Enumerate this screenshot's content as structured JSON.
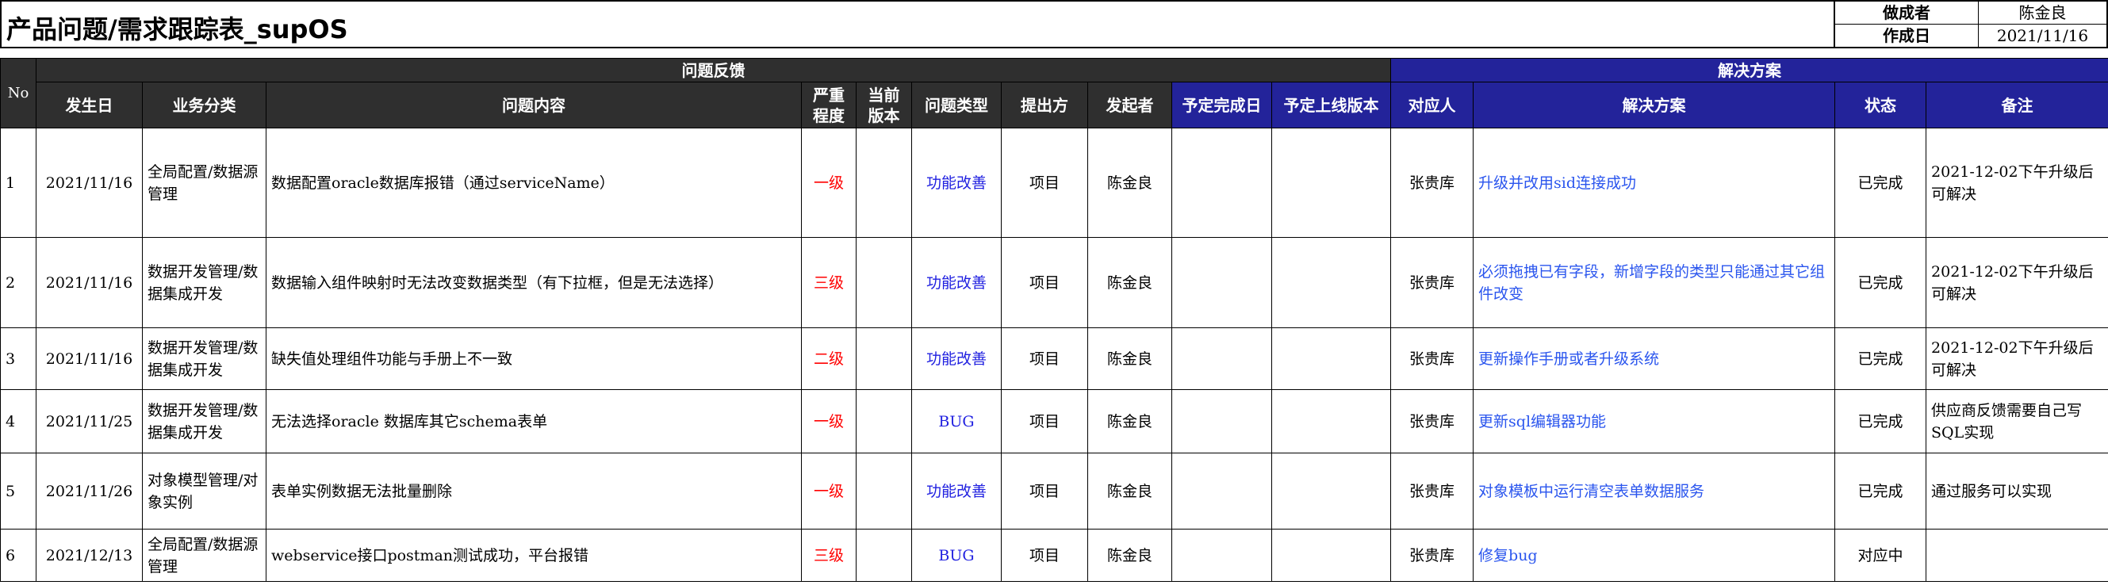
{
  "header": {
    "title": "产品问题/需求跟踪表_supOS",
    "author_label": "做成者",
    "author_value": "陈金良",
    "date_label": "作成日",
    "date_value": "2021/11/16"
  },
  "groups": {
    "feedback": "问题反馈",
    "solution": "解决方案"
  },
  "columns": {
    "no": "No",
    "date": "发生日",
    "category": "业务分类",
    "content": "问题内容",
    "severity_1": "严重",
    "severity_2": "程度",
    "version_1": "当前",
    "version_2": "版本",
    "type": "问题类型",
    "proposer": "提出方",
    "initiator": "发起者",
    "planned_date": "予定完成日",
    "planned_version": "予定上线版本",
    "assignee": "对应人",
    "solution": "解决方案",
    "status": "状态",
    "remark": "备注"
  },
  "rows": [
    {
      "no": "1",
      "date": "2021/11/16",
      "category": "全局配置/数据源管理",
      "content": "数据配置oracle数据库报错（通过serviceName）",
      "severity": "一级",
      "version": "",
      "type": "功能改善",
      "proposer": "项目",
      "initiator": "陈金良",
      "planned_date": "",
      "planned_version": "",
      "assignee": "张贵库",
      "solution": "升级并改用sid连接成功",
      "status": "已完成",
      "remark": "2021-12-02下午升级后可解决"
    },
    {
      "no": "2",
      "date": "2021/11/16",
      "category": "数据开发管理/数据集成开发",
      "content": "数据输入组件映射时无法改变数据类型（有下拉框，但是无法选择）",
      "severity": "三级",
      "version": "",
      "type": "功能改善",
      "proposer": "项目",
      "initiator": "陈金良",
      "planned_date": "",
      "planned_version": "",
      "assignee": "张贵库",
      "solution": "必须拖拽已有字段，新增字段的类型只能通过其它组件改变",
      "status": "已完成",
      "remark": "2021-12-02下午升级后可解决"
    },
    {
      "no": "3",
      "date": "2021/11/16",
      "category": "数据开发管理/数据集成开发",
      "content": "缺失值处理组件功能与手册上不一致",
      "severity": "二级",
      "version": "",
      "type": "功能改善",
      "proposer": "项目",
      "initiator": "陈金良",
      "planned_date": "",
      "planned_version": "",
      "assignee": "张贵库",
      "solution": "更新操作手册或者升级系统",
      "status": "已完成",
      "remark": "2021-12-02下午升级后可解决"
    },
    {
      "no": "4",
      "date": "2021/11/25",
      "category": "数据开发管理/数据集成开发",
      "content": "无法选择oracle 数据库其它schema表单",
      "severity": "一级",
      "version": "",
      "type": "BUG",
      "proposer": "项目",
      "initiator": "陈金良",
      "planned_date": "",
      "planned_version": "",
      "assignee": "张贵库",
      "solution": "更新sql编辑器功能",
      "status": "已完成",
      "remark": "供应商反馈需要自己写SQL实现"
    },
    {
      "no": "5",
      "date": "2021/11/26",
      "category": "对象模型管理/对象实例",
      "content": "表单实例数据无法批量删除",
      "severity": "一级",
      "version": "",
      "type": "功能改善",
      "proposer": "项目",
      "initiator": "陈金良",
      "planned_date": "",
      "planned_version": "",
      "assignee": "张贵库",
      "solution": "对象模板中运行清空表单数据服务",
      "status": "已完成",
      "remark": "通过服务可以实现"
    },
    {
      "no": "6",
      "date": "2021/12/13",
      "category": "全局配置/数据源管理",
      "content": "webservice接口postman测试成功，平台报错",
      "severity": "三级",
      "version": "",
      "type": "BUG",
      "proposer": "项目",
      "initiator": "陈金良",
      "planned_date": "",
      "planned_version": "",
      "assignee": "张贵库",
      "solution": "修复bug",
      "status": "对应中",
      "remark": ""
    }
  ],
  "colors": {
    "header_dark": "#2f2f2f",
    "header_blue": "#23239a",
    "severity": "#ff0000",
    "type": "#2020e0",
    "solution": "#2a55ee"
  }
}
